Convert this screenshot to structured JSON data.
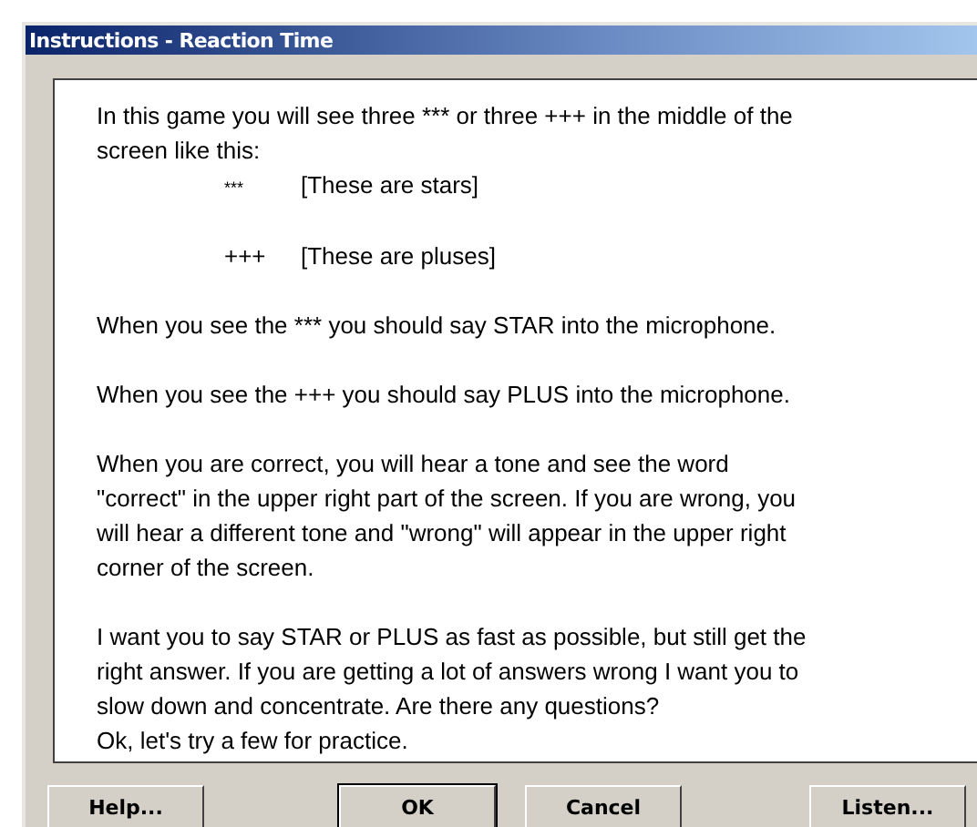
{
  "window": {
    "title": "Instructions - Reaction Time"
  },
  "instructions": [
    {
      "kind": "text",
      "text": "In this game you will see three *** or three +++ in the middle of the\nscreen like this:"
    },
    {
      "kind": "example",
      "symbol": "***",
      "caption": "[These are stars]",
      "small": true
    },
    {
      "kind": "example",
      "symbol": "+++",
      "caption": "[These are pluses]",
      "small": false
    },
    {
      "kind": "text",
      "text": "When you see the  *** you should say STAR into the microphone."
    },
    {
      "kind": "text",
      "text": "When you see the  +++ you should say PLUS into the microphone."
    },
    {
      "kind": "text",
      "text": "When you are correct, you will hear a tone and see the word\n\"correct\" in the upper right part of the screen.  If you are wrong, you\nwill hear a different tone and \"wrong\" will appear in the upper right\ncorner of the screen."
    },
    {
      "kind": "text",
      "text": "I want you to say STAR or PLUS as fast as possible, but still get the\nright answer. If you are getting a lot of answers wrong I want you to\nslow down and concentrate.  Are there any questions?\nOk, let's try a few for practice."
    }
  ],
  "buttons": [
    {
      "label": "Help...",
      "selected": false
    },
    {
      "label": "OK",
      "selected": true
    },
    {
      "label": "Cancel",
      "selected": false
    },
    {
      "label": "Listen...",
      "selected": false
    }
  ]
}
